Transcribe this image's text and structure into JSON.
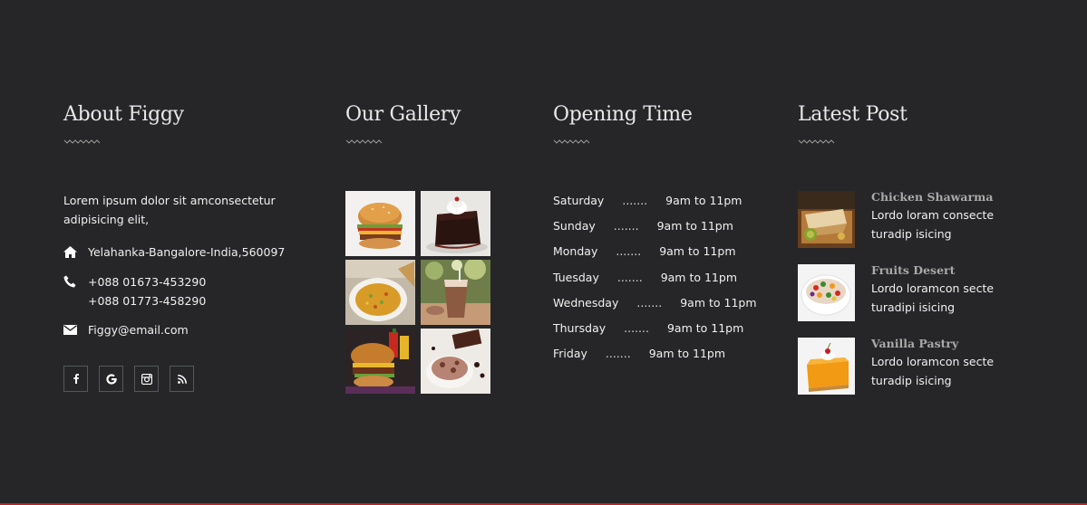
{
  "about": {
    "heading": "About Figgy",
    "text": "Lorem ipsum dolor sit amconsectetur adipisicing elit,",
    "address": "Yelahanka-Bangalore-India,560097",
    "phone_1": "+088 01673-453290",
    "phone_2": "+088 01773-458290",
    "email": "Figgy@email.com",
    "social": [
      "facebook-icon",
      "google-icon",
      "instagram-icon",
      "rss-icon"
    ]
  },
  "gallery": {
    "heading": "Our Gallery",
    "images": [
      "burger",
      "chocolate-cake",
      "biryani",
      "iced-coffee",
      "burger-and-sauces",
      "chocolate-ice-cream"
    ]
  },
  "hours": {
    "heading": "Opening Time",
    "rows": [
      {
        "day": "Saturday",
        "dots": ".......",
        "time": "9am to 11pm"
      },
      {
        "day": "Sunday",
        "dots": ".......",
        "time": "9am to 11pm"
      },
      {
        "day": "Monday",
        "dots": ".......",
        "time": "9am to 11pm"
      },
      {
        "day": "Tuesday",
        "dots": ".......",
        "time": "9am to 11pm"
      },
      {
        "day": "Wednesday",
        "dots": ".......",
        "time": "9am to 11pm"
      },
      {
        "day": "Thursday",
        "dots": ".......",
        "time": "9am to 11pm"
      },
      {
        "day": "Friday",
        "dots": ".......",
        "time": "9am to 11pm"
      }
    ]
  },
  "posts": {
    "heading": "Latest Post",
    "items": [
      {
        "title": "Chicken Shawarma",
        "excerpt": "Lordo loram consecte turadip isicing",
        "image": "shawarma"
      },
      {
        "title": "Fruits Desert",
        "excerpt": "Lordo loramcon secte turadipi isicing",
        "image": "fruit-salad"
      },
      {
        "title": "Vanilla Pastry",
        "excerpt": "Lordo loramcon secte turadip isicing",
        "image": "pastry"
      }
    ]
  },
  "colors": {
    "background": "#262628",
    "accent_line": "#b5262a",
    "heading": "#e8e8e8",
    "post_title": "#a9a9a9"
  }
}
